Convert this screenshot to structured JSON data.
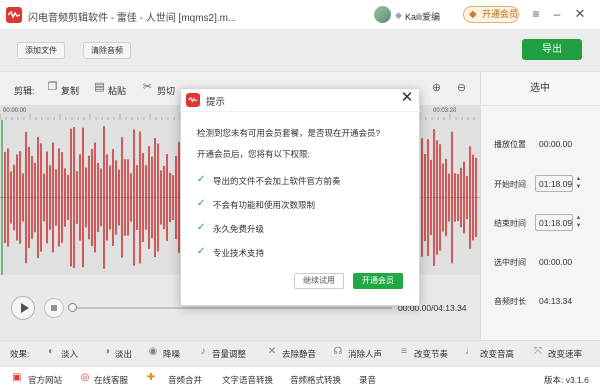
{
  "app": {
    "window_title": "闪电音频剪辑软件 - 雷佳 - 人世间 [mqms2].m...",
    "user_name": "Kaili爱编",
    "vip_button": "开通会员"
  },
  "toolbar": {
    "add_file": "添加文件",
    "clear_audio": "清除音频",
    "export": "导出"
  },
  "edit": {
    "label": "剪辑:",
    "copy": "复制",
    "paste": "粘贴",
    "cut": "剪切"
  },
  "ruler": {
    "left_time": "00:00:00",
    "right_time": "00:03:20"
  },
  "right_panel": {
    "header": "选中",
    "play_position_label": "播放位置",
    "play_position_value": "00:00.00",
    "start_time_label": "开始时间",
    "start_time_value": "01:18.09",
    "end_time_label": "结束时间",
    "end_time_value": "01:18.09",
    "selected_time_label": "选中时间",
    "selected_time_value": "00:00.00",
    "duration_label": "音频时长",
    "duration_value": "04:13.34"
  },
  "player": {
    "time_display": "00:00.00/04:13.34"
  },
  "effects": {
    "label": "效果:",
    "items": [
      "淡入",
      "淡出",
      "降噪",
      "音量调整",
      "去除静音",
      "消除人声",
      "改变节奏",
      "改变音高",
      "改变速率"
    ]
  },
  "status": {
    "website": "官方网站",
    "support": "在线客服",
    "merge": "音频合并",
    "tts": "文字语音转换",
    "format": "音频格式转换",
    "record": "录音",
    "version": "版本: v3.1.6"
  },
  "dialog": {
    "title": "提示",
    "message": "检测到您未有可用会员套餐，是否现在开通会员?",
    "privileges_intro": "开通会员后，您将有以下权限:",
    "features": [
      "导出的文件不会加上软件官方前奏",
      "不会有功能和使用次数限制",
      "永久免费升级",
      "专业技术支持"
    ],
    "try_button": "继续试用",
    "open_button": "开通会员"
  },
  "colors": {
    "accent_green": "#22a745",
    "brand_red": "#e03535",
    "waveform": "#d33b3b"
  }
}
